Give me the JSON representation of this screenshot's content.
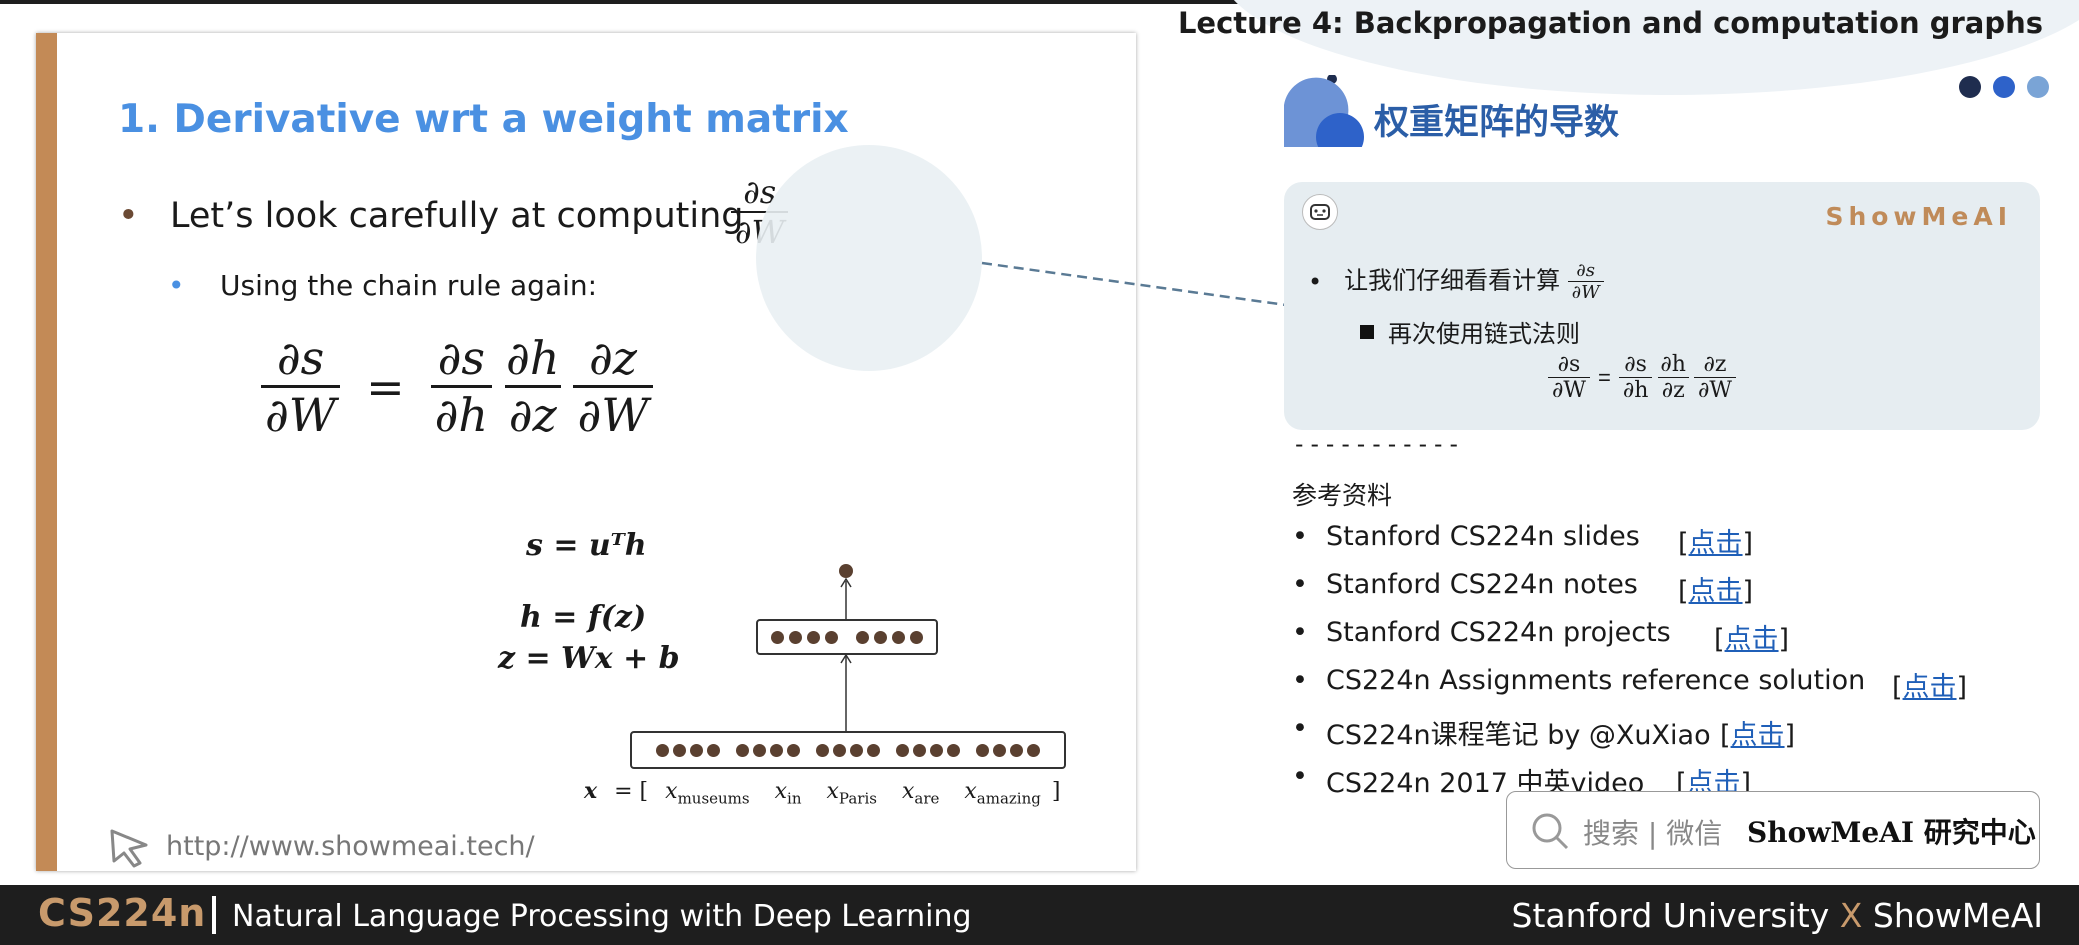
{
  "header": {
    "lecture_title": "Lecture 4:  Backpropagation and computation graphs",
    "dot_colors": [
      "#1f2d4f",
      "#2e62c9",
      "#7aa4d6"
    ]
  },
  "slide": {
    "title": "1. Derivative wrt a weight matrix",
    "bullet1": "Let’s look carefully at computing",
    "bullet1_frac": {
      "num": "∂s",
      "den": "∂W"
    },
    "bullet2": "Using the chain rule again:",
    "chain_rule": {
      "lhs": {
        "num": "∂s",
        "den": "∂W"
      },
      "eq": "=",
      "rhs": [
        {
          "num": "∂s",
          "den": "∂h"
        },
        {
          "num": "∂h",
          "den": "∂z"
        },
        {
          "num": "∂z",
          "den": "∂W"
        }
      ]
    },
    "formulas": {
      "s": "s = uᵀh",
      "h": "h = f(z)",
      "z": "z = Wx + b"
    },
    "x_vector": {
      "prefix": "x",
      "eq": "= [",
      "terms": [
        {
          "var": "x",
          "sub": "museums"
        },
        {
          "var": "x",
          "sub": "in"
        },
        {
          "var": "x",
          "sub": "Paris"
        },
        {
          "var": "x",
          "sub": "are"
        },
        {
          "var": "x",
          "sub": "amazing"
        }
      ],
      "close": "]"
    },
    "url": "http://www.showmeai.tech/",
    "accent_color": "#c38a56",
    "title_color": "#4a90e2"
  },
  "notes": {
    "section_title": "权重矩阵的导数",
    "brand": "ShowMeAI",
    "bullet1": "让我们仔细看看计算",
    "bullet1_frac": {
      "num": "∂s",
      "den": "∂W"
    },
    "bullet2": "再次使用链式法则",
    "equation": {
      "lhs": {
        "num": "∂s",
        "den": "∂W"
      },
      "eq": "=",
      "rhs": [
        {
          "num": "∂s",
          "den": "∂h"
        },
        {
          "num": "∂h",
          "den": "∂z"
        },
        {
          "num": "∂z",
          "den": "∂W"
        }
      ]
    },
    "separator": "-----------",
    "ref_title": "参考资料",
    "references": [
      {
        "label": "Stanford CS224n slides",
        "link": "点击"
      },
      {
        "label": "Stanford CS224n notes",
        "link": "点击"
      },
      {
        "label": "Stanford CS224n projects",
        "link": "点击"
      },
      {
        "label": "CS224n Assignments reference solution",
        "link": "点击"
      },
      {
        "label": "CS224n课程笔记 by @XuXiao",
        "link": "点击"
      },
      {
        "label": "CS224n 2017 中英video",
        "link": "点击"
      }
    ],
    "search": {
      "text": "搜索 | 微信",
      "brand": "ShowMeAI 研究中心"
    }
  },
  "footer": {
    "course": "CS224n",
    "subtitle": "Natural Language Processing with Deep Learning",
    "right_a": "Stanford University",
    "right_x": "X",
    "right_b": "ShowMeAI"
  }
}
